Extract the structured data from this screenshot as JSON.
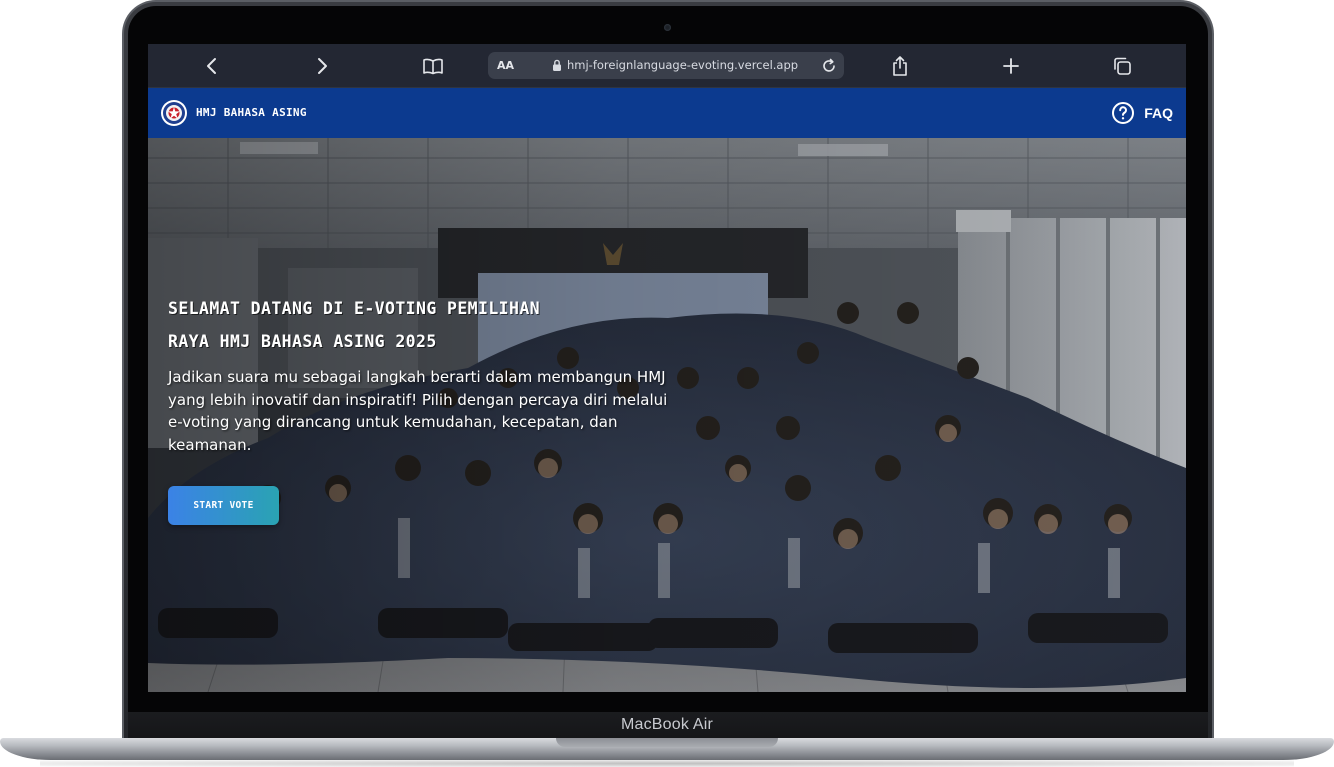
{
  "device": {
    "model_label": "MacBook Air"
  },
  "browser": {
    "text_size_label": "AA",
    "url": "hmj-foreignlanguage-evoting.vercel.app",
    "icons": [
      "chevron-left-icon",
      "chevron-right-icon",
      "book-icon",
      "lock-icon",
      "reload-icon",
      "share-icon",
      "plus-icon",
      "tabs-icon"
    ]
  },
  "navbar": {
    "brand": "HMJ Bahasa Asing",
    "faq_label": "FAQ",
    "background_color": "#0c3a8f"
  },
  "hero": {
    "title_line1": "Selamat Datang di E-Voting Pemilihan",
    "title_line2": "Raya HMJ Bahasa Asing 2025",
    "description": "Jadikan suara mu sebagai langkah berarti dalam membangun HMJ yang lebih inovatif dan inspiratif! Pilih dengan percaya diri melalui e-voting yang dirancang untuk kemudahan, kecepatan, dan keamanan.",
    "cta_label": "Start Vote",
    "cta_gradient": [
      "#3b82e6",
      "#2aa3b3"
    ]
  }
}
